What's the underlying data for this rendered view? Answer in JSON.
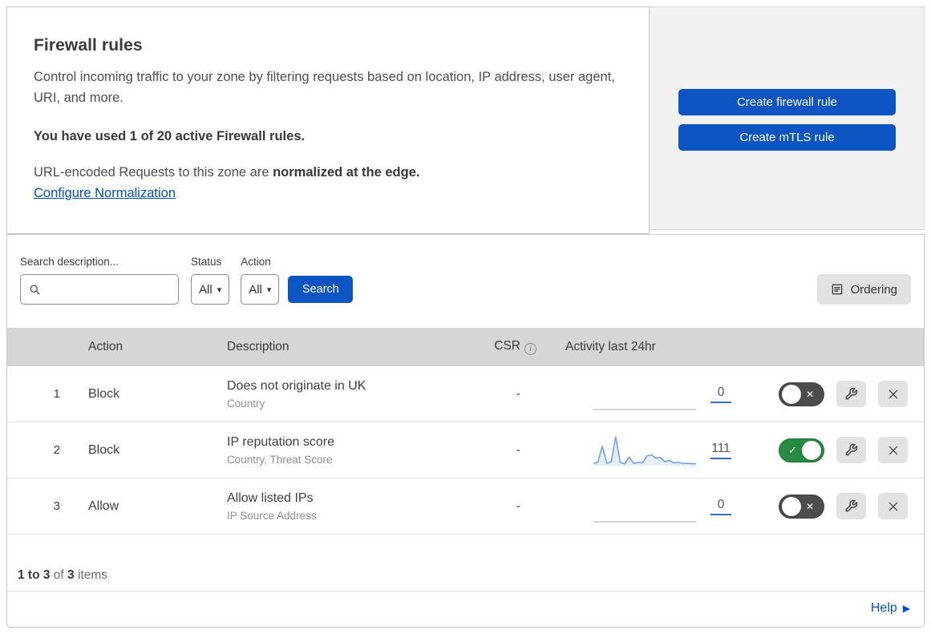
{
  "intro": {
    "title": "Firewall rules",
    "description": "Control incoming traffic to your zone by filtering requests based on location, IP address, user agent, URI, and more.",
    "usage_line": "You have used 1 of 20 active Firewall rules.",
    "normalization_prefix": "URL-encoded Requests to this zone are ",
    "normalization_bold": "normalized at the edge.",
    "normalization_link": "Configure Normalization"
  },
  "actions_panel": {
    "create_firewall_rule": "Create firewall rule",
    "create_mtls_rule": "Create mTLS rule"
  },
  "filters": {
    "search_label": "Search description...",
    "status_label": "Status",
    "status_value": "All",
    "action_label": "Action",
    "action_value": "All",
    "search_button": "Search",
    "ordering_button": "Ordering"
  },
  "table": {
    "columns": {
      "action": "Action",
      "description": "Description",
      "csr": "CSR",
      "activity": "Activity last 24hr"
    },
    "rows": [
      {
        "number": "1",
        "action": "Block",
        "description": "Does not originate in UK",
        "match_fields": "Country",
        "csr": "-",
        "activity_count": "0",
        "enabled": "off",
        "sparkline": []
      },
      {
        "number": "2",
        "action": "Block",
        "description": "IP reputation score",
        "match_fields": "Country, Threat Score",
        "csr": "-",
        "activity_count": "111",
        "enabled": "on",
        "sparkline": [
          8,
          12,
          68,
          8,
          14,
          100,
          12,
          6,
          30,
          8,
          12,
          10,
          34,
          38,
          26,
          28,
          14,
          18,
          10,
          12,
          8,
          8,
          7,
          7
        ]
      },
      {
        "number": "3",
        "action": "Allow",
        "description": "Allow listed IPs",
        "match_fields": "IP Source Address",
        "csr": "-",
        "activity_count": "0",
        "enabled": "off",
        "sparkline": []
      }
    ]
  },
  "footer": {
    "range": "1 to 3",
    "of_word": "of",
    "total": "3",
    "items_word": "items"
  },
  "help": {
    "label": "Help"
  },
  "colors": {
    "primary_blue": "#0a55c3",
    "link_blue": "#0051c3",
    "toggle_on": "#278a43",
    "toggle_off": "#4d4d4d",
    "sparkline_line": "#6e9ceb",
    "sparkline_fill": "rgba(110,156,235,0.18)",
    "flatline_gray": "#c5c5c5"
  }
}
